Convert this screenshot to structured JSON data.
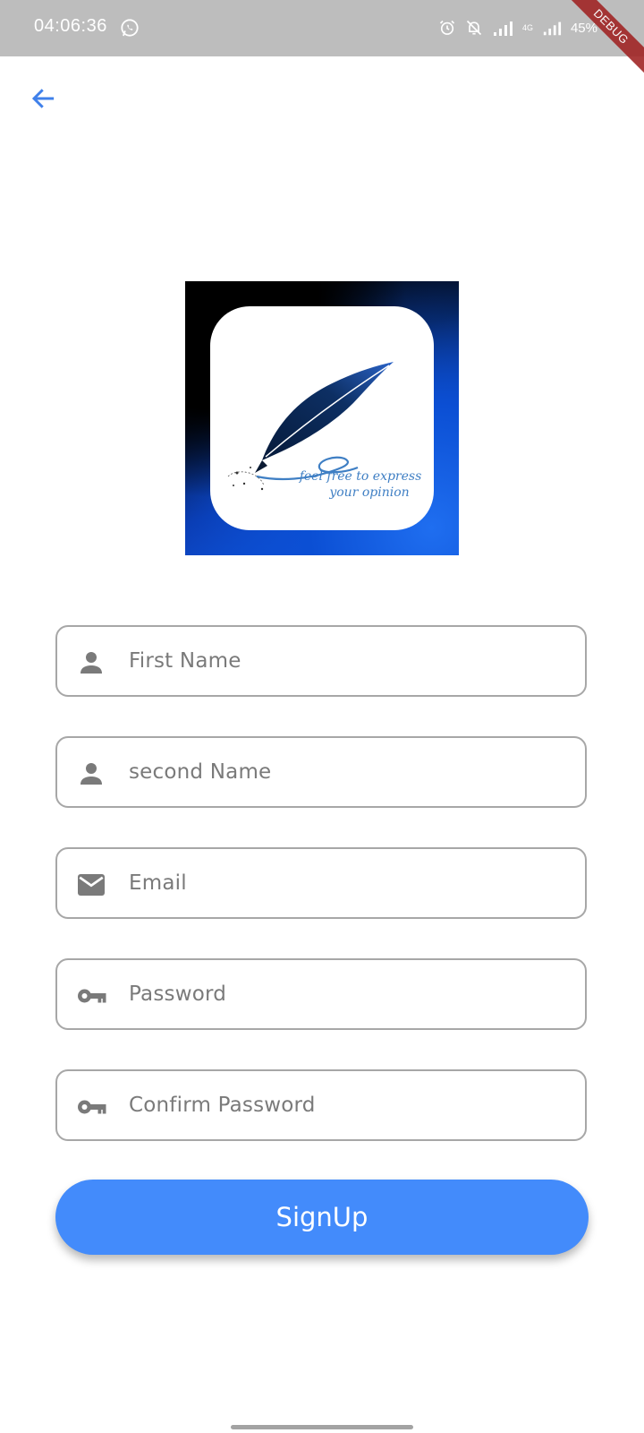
{
  "status_bar": {
    "time": "04:06:36",
    "network_label": "4G",
    "battery": "45%",
    "debug_label": "DEBUG"
  },
  "header": {
    "back_icon": "arrow-back-icon",
    "accent_color": "#3f80ea"
  },
  "logo": {
    "tagline_line1": "feel free to express",
    "tagline_line2": "your opinion"
  },
  "form": {
    "fields": [
      {
        "icon": "person-icon",
        "placeholder": "First Name"
      },
      {
        "icon": "person-icon",
        "placeholder": "second Name"
      },
      {
        "icon": "email-icon",
        "placeholder": "Email"
      },
      {
        "icon": "key-icon",
        "placeholder": "Password"
      },
      {
        "icon": "key-icon",
        "placeholder": "Confirm Password"
      }
    ],
    "submit_label": "SignUp",
    "submit_color": "#438bfb"
  }
}
